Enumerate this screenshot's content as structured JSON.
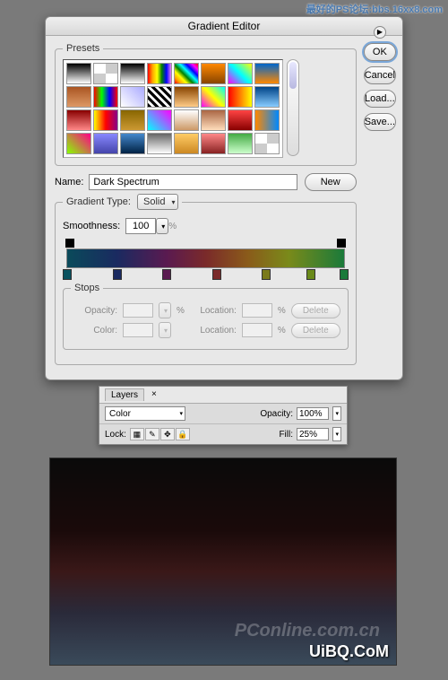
{
  "watermarks": {
    "top": "最好的PS论坛:bbs.16xx8.com",
    "pconline": "PConline.com.cn",
    "uibq": "UiBQ.CoM"
  },
  "dialog": {
    "title": "Gradient Editor",
    "buttons": {
      "ok": "OK",
      "cancel": "Cancel",
      "load": "Load...",
      "save": "Save...",
      "new": "New"
    },
    "presets_label": "Presets",
    "name_label": "Name:",
    "name_value": "Dark Spectrum",
    "gradient_type_label": "Gradient Type:",
    "gradient_type_value": "Solid",
    "smoothness_label": "Smoothness:",
    "smoothness_value": "100",
    "percent": "%",
    "stops": {
      "legend": "Stops",
      "opacity_label": "Opacity:",
      "color_label": "Color:",
      "location_label": "Location:",
      "delete": "Delete"
    },
    "color_stops": [
      {
        "pos": 0,
        "color": "#0a525f"
      },
      {
        "pos": 18,
        "color": "#1a2a60"
      },
      {
        "pos": 36,
        "color": "#5a1a50"
      },
      {
        "pos": 54,
        "color": "#7a2a2a"
      },
      {
        "pos": 72,
        "color": "#7a7a1a"
      },
      {
        "pos": 88,
        "color": "#6a8a1a"
      },
      {
        "pos": 100,
        "color": "#1a7a3a"
      }
    ]
  },
  "layers": {
    "tab": "Layers",
    "blend_mode": "Color",
    "opacity_label": "Opacity:",
    "opacity_value": "100%",
    "lock_label": "Lock:",
    "fill_label": "Fill:",
    "fill_value": "25%"
  }
}
